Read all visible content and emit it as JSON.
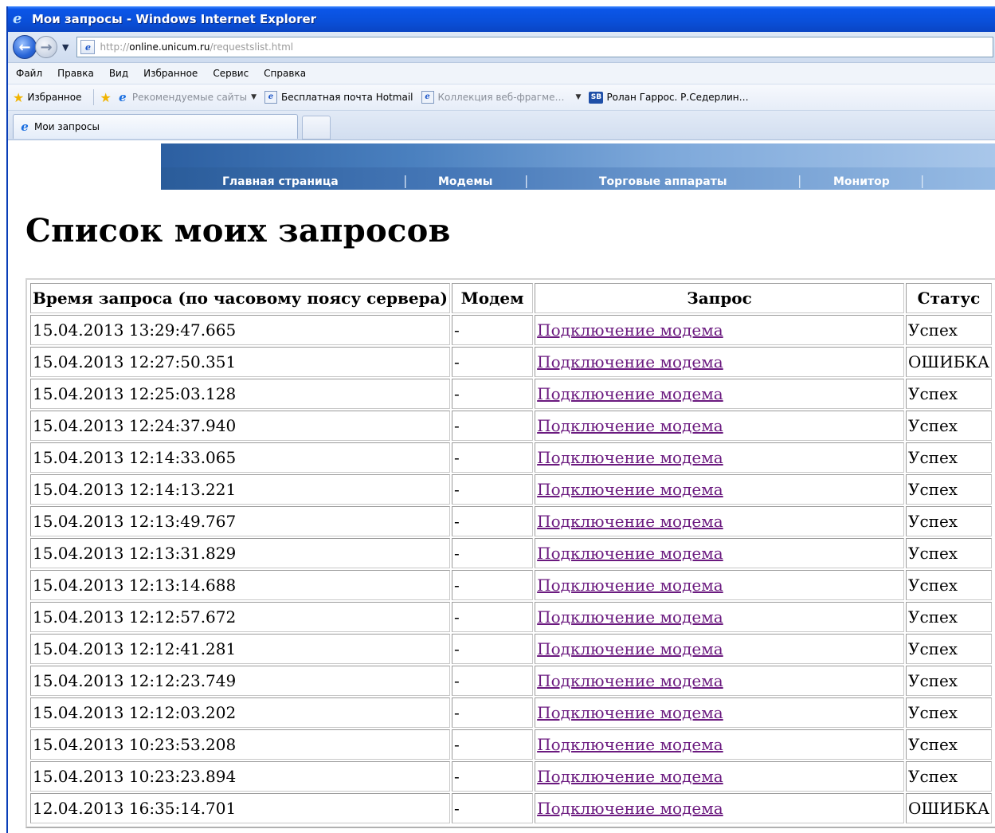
{
  "window": {
    "title": "Мои запросы - Windows Internet Explorer"
  },
  "address": {
    "prefix": "http://",
    "host": "online.unicum.ru",
    "path": "/requestslist.html"
  },
  "menu": [
    "Файл",
    "Правка",
    "Вид",
    "Избранное",
    "Сервис",
    "Справка"
  ],
  "favorites": {
    "label": "Избранное",
    "items": [
      {
        "label": "Рекомендуемые сайты",
        "dim": true
      },
      {
        "label": "Бесплатная почта Hotmail",
        "dim": false
      },
      {
        "label": "Коллекция веб-фрагме…",
        "dim": true
      },
      {
        "label": "Ролан Гаррос. Р.Седерлин…",
        "dim": false
      }
    ]
  },
  "tab": {
    "title": "Мои запросы"
  },
  "sitenav": {
    "items": [
      "Главная страница",
      "Модемы",
      "Торговые аппараты",
      "Монитор"
    ]
  },
  "page": {
    "title": "Список моих запросов"
  },
  "table": {
    "headers": [
      "Время запроса (по часовому поясу сервера)",
      "Модем",
      "Запрос",
      "Статус"
    ],
    "rows": [
      [
        "15.04.2013 13:29:47.665",
        "-",
        "Подключение модема",
        "Успех"
      ],
      [
        "15.04.2013 12:27:50.351",
        "-",
        "Подключение модема",
        "ОШИБКА"
      ],
      [
        "15.04.2013 12:25:03.128",
        "-",
        "Подключение модема",
        "Успех"
      ],
      [
        "15.04.2013 12:24:37.940",
        "-",
        "Подключение модема",
        "Успех"
      ],
      [
        "15.04.2013 12:14:33.065",
        "-",
        "Подключение модема",
        "Успех"
      ],
      [
        "15.04.2013 12:14:13.221",
        "-",
        "Подключение модема",
        "Успех"
      ],
      [
        "15.04.2013 12:13:49.767",
        "-",
        "Подключение модема",
        "Успех"
      ],
      [
        "15.04.2013 12:13:31.829",
        "-",
        "Подключение модема",
        "Успех"
      ],
      [
        "15.04.2013 12:13:14.688",
        "-",
        "Подключение модема",
        "Успех"
      ],
      [
        "15.04.2013 12:12:57.672",
        "-",
        "Подключение модема",
        "Успех"
      ],
      [
        "15.04.2013 12:12:41.281",
        "-",
        "Подключение модема",
        "Успех"
      ],
      [
        "15.04.2013 12:12:23.749",
        "-",
        "Подключение модема",
        "Успех"
      ],
      [
        "15.04.2013 12:12:03.202",
        "-",
        "Подключение модема",
        "Успех"
      ],
      [
        "15.04.2013 10:23:53.208",
        "-",
        "Подключение модема",
        "Успех"
      ],
      [
        "15.04.2013 10:23:23.894",
        "-",
        "Подключение модема",
        "Успех"
      ],
      [
        "12.04.2013 16:35:14.701",
        "-",
        "Подключение модема",
        "ОШИБКА"
      ]
    ]
  },
  "colors": {
    "titlebar": "#0a4fd8",
    "link_visited": "#6b1a7f",
    "nav_band": "#4a80bf"
  }
}
